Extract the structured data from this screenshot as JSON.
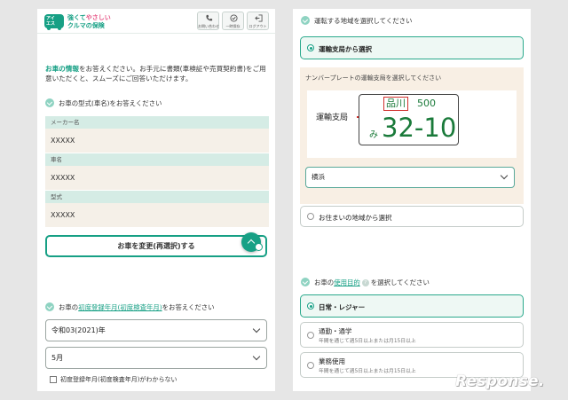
{
  "header": {
    "logo_mark_text": "アイ\nエス",
    "logo_line1_a": "強くて",
    "logo_line1_b": "やさしい",
    "logo_line2": "クルマの保険",
    "buttons": [
      {
        "label": "お問い合わせ",
        "icon": "phone-icon"
      },
      {
        "label": "一時保存",
        "icon": "save-icon"
      },
      {
        "label": "ログアウト",
        "icon": "logout-icon"
      }
    ]
  },
  "left": {
    "intro_highlight": "お車の情報",
    "intro_rest": "をお答えください。お手元に書類(車検証や売買契約書)をご用意いただくと、スムーズにご回答いただけます。",
    "q1": "お車の型式(車名)をお答えください",
    "fields": [
      {
        "label": "メーカー名",
        "value": "XXXXX"
      },
      {
        "label": "車名",
        "value": "XXXXX"
      },
      {
        "label": "型式",
        "value": "XXXXX"
      }
    ],
    "change_button": "お車を変更(再選択)する",
    "q2_prefix": "お車の",
    "q2_link": "初度登録年月(初度検査年月)",
    "q2_suffix": "をお答えください",
    "year_value": "令和03(2021)年",
    "month_value": "5月",
    "unknown_checkbox": "初度登録年月(初度検査年月)がわからない"
  },
  "right": {
    "q_region": "運転する地域を選択してください",
    "opt_office": "運輸支局から選択",
    "plate_instruction": "ナンバープレートの運輸支局を選択してください",
    "plate_label": "運輸支局",
    "plate": {
      "office": "品川",
      "class_no": "500",
      "kana": "み",
      "number": "32-10"
    },
    "office_value": "横浜",
    "opt_residence": "お住まいの地域から選択",
    "q_usage_prefix": "お車の",
    "q_usage_link": "使用目的",
    "q_usage_suffix": "を選択してください",
    "usage_options": [
      {
        "label": "日常・レジャー",
        "sub": "",
        "selected": true
      },
      {
        "label": "通勤・通学",
        "sub": "年間を通じて週5日以上または月15日以上",
        "selected": false
      },
      {
        "label": "業務使用",
        "sub": "年間を通じて週5日以上または月15日以上",
        "selected": false
      }
    ]
  },
  "watermark": "Response."
}
